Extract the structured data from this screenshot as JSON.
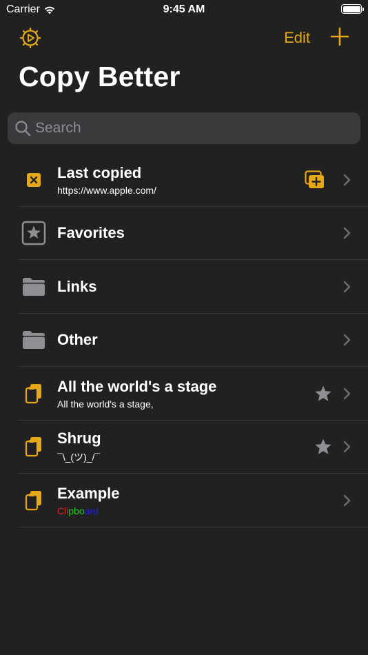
{
  "status": {
    "carrier": "Carrier",
    "time": "9:45 AM"
  },
  "nav": {
    "edit_label": "Edit"
  },
  "title": "Copy Better",
  "search": {
    "placeholder": "Search",
    "value": ""
  },
  "rows": [
    {
      "title": "Last copied",
      "subtitle": "https://www.apple.com/"
    },
    {
      "title": "Favorites"
    },
    {
      "title": "Links"
    },
    {
      "title": "Other"
    },
    {
      "title": "All the world's a stage",
      "subtitle": "All the world's a stage,"
    },
    {
      "title": "Shrug",
      "subtitle": "¯\\_(ツ)_/¯"
    },
    {
      "title": "Example",
      "subtitle_parts": [
        "Cli",
        "pbo",
        "ard"
      ]
    }
  ],
  "colors": {
    "accent": "#e6a817",
    "background": "#212121",
    "search_bg": "#3a3a3c",
    "icon_gray": "#8e8e93"
  }
}
